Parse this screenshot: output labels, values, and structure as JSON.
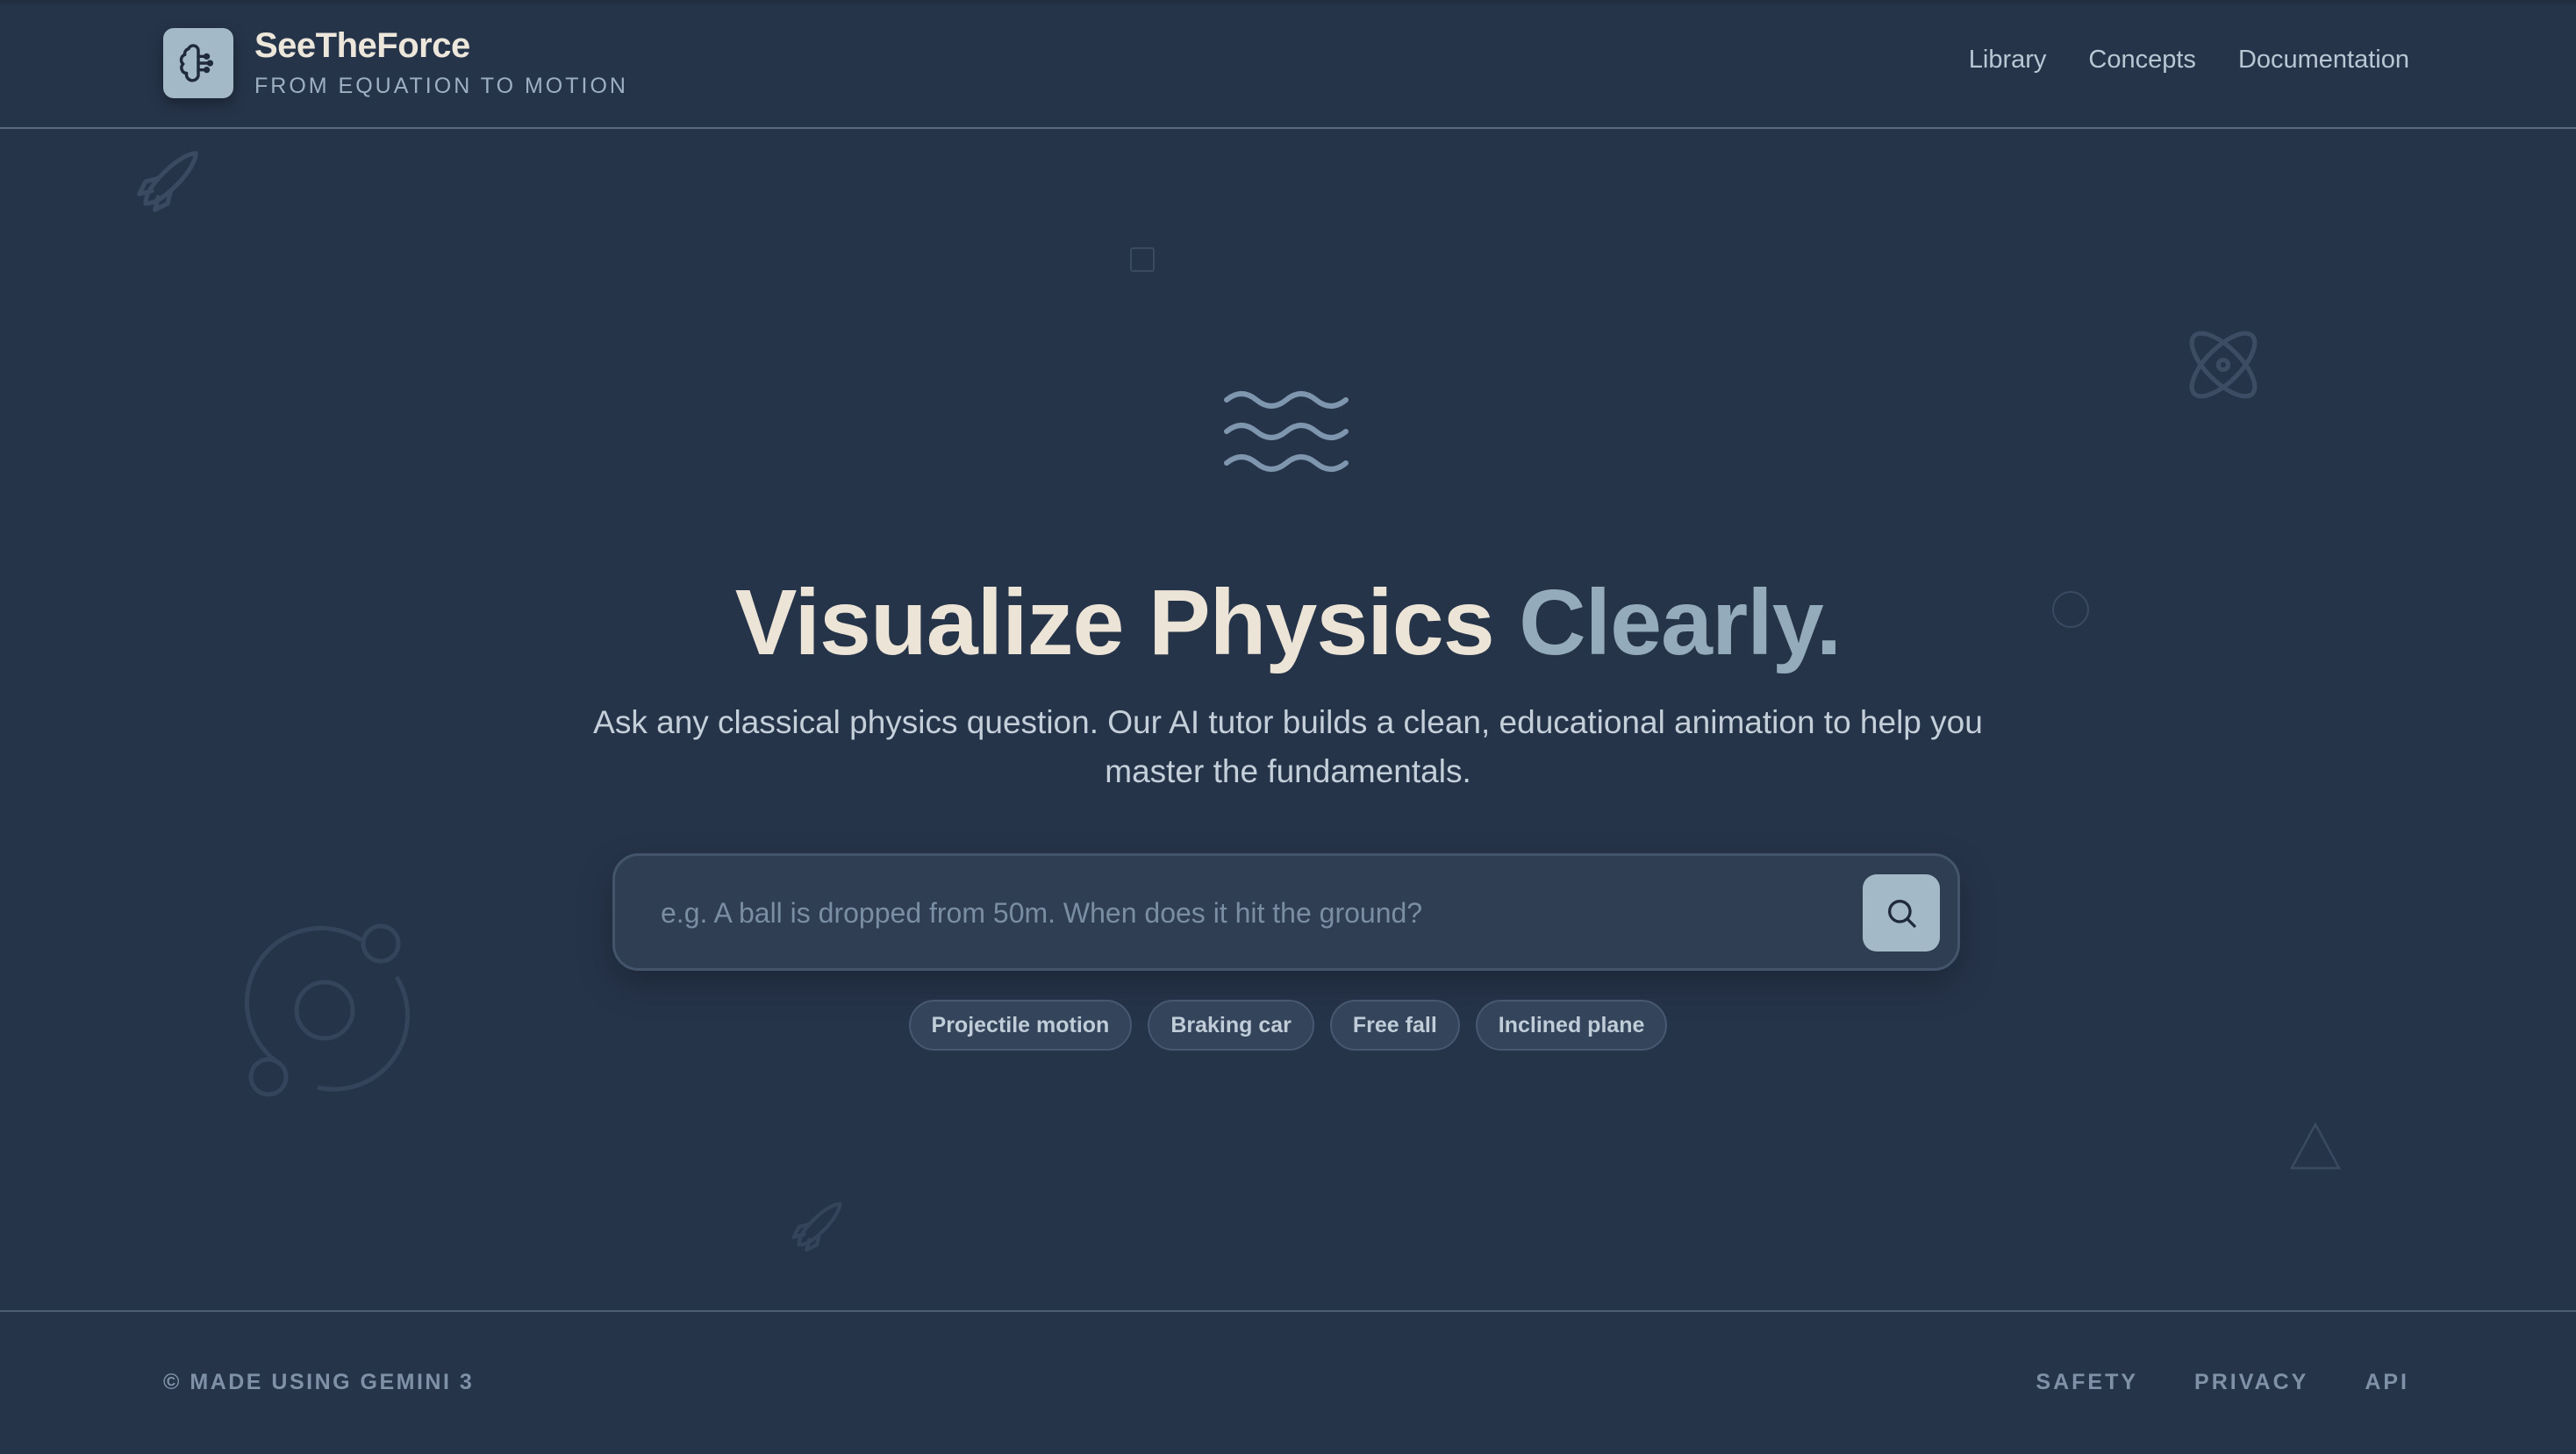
{
  "header": {
    "brand_name": "SeeTheForce",
    "brand_tagline": "FROM EQUATION TO MOTION",
    "logo_icon": "brain-icon",
    "nav": [
      {
        "label": "Library"
      },
      {
        "label": "Concepts"
      },
      {
        "label": "Documentation"
      }
    ]
  },
  "hero": {
    "icon": "waves-icon",
    "title_main": "Visualize Physics ",
    "title_accent": "Clearly.",
    "subtitle": "Ask any classical physics question. Our AI tutor builds a clean, educational animation to help you master the fundamentals.",
    "search": {
      "value": "",
      "placeholder": "e.g. A ball is dropped from 50m. When does it hit the ground?",
      "button_icon": "search-icon"
    },
    "suggestions": [
      {
        "label": "Projectile motion"
      },
      {
        "label": "Braking car"
      },
      {
        "label": "Free fall"
      },
      {
        "label": "Inclined plane"
      }
    ]
  },
  "footer": {
    "copyright": "© MADE USING GEMINI 3",
    "links": [
      {
        "label": "SAFETY"
      },
      {
        "label": "PRIVACY"
      },
      {
        "label": "API"
      }
    ]
  },
  "colors": {
    "background": "#26344a",
    "accent": "#a3b9c8",
    "title": "#ece4d6",
    "title_accent": "#94abbb"
  }
}
